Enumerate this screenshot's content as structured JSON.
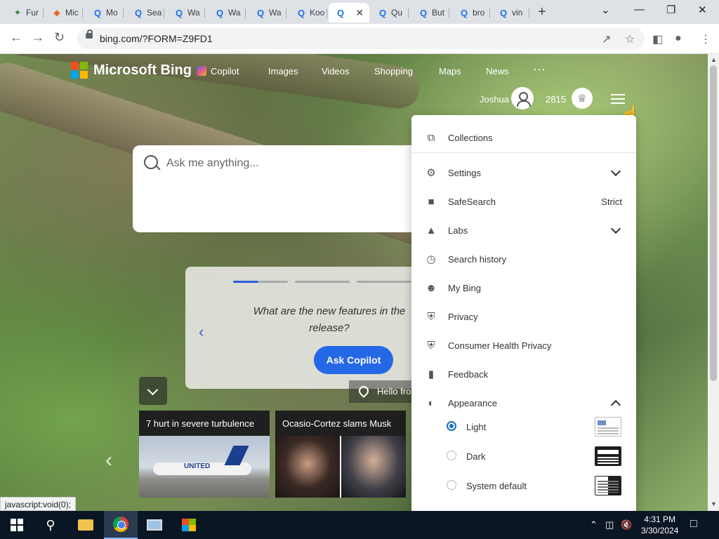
{
  "browser": {
    "tabs": [
      {
        "label": "Fur",
        "icon": "leaf"
      },
      {
        "label": "Mic",
        "icon": "shield"
      },
      {
        "label": "Mo",
        "icon": "search"
      },
      {
        "label": "Sea",
        "icon": "search"
      },
      {
        "label": "Wa",
        "icon": "search"
      },
      {
        "label": "Wa",
        "icon": "search"
      },
      {
        "label": "Wa",
        "icon": "search"
      },
      {
        "label": "Koo",
        "icon": "search"
      },
      {
        "label": "",
        "icon": "search",
        "active": true
      },
      {
        "label": "Qu",
        "icon": "search"
      },
      {
        "label": "But",
        "icon": "search"
      },
      {
        "label": "bro",
        "icon": "search"
      },
      {
        "label": "vin",
        "icon": "search"
      }
    ],
    "url": "bing.com/?FORM=Z9FD1",
    "status_text": "javascript:void(0);"
  },
  "bing": {
    "logo_text": "Microsoft Bing",
    "nav": [
      "Copilot",
      "Images",
      "Videos",
      "Shopping",
      "Maps",
      "News"
    ],
    "more": "···",
    "user_name": "Joshua",
    "points": "2815",
    "search_placeholder": "Ask me anything...",
    "prompt_question": "What are the new features in the release?",
    "ask_button": "Ask Copilot",
    "hello_text": "Hello fro",
    "carousel_active_index": 0,
    "news": [
      {
        "headline": "7 hurt in severe turbulence",
        "image": "airplane",
        "image_text": "UNITED"
      },
      {
        "headline": "Ocasio-Cortez slams Musk",
        "image": "people"
      }
    ]
  },
  "menu": {
    "items": [
      {
        "label": "Collections",
        "icon": "collections"
      },
      {
        "label": "Settings",
        "icon": "gear",
        "chevron": "down"
      },
      {
        "label": "SafeSearch",
        "icon": "lock",
        "value": "Strict"
      },
      {
        "label": "Labs",
        "icon": "flask",
        "chevron": "down"
      },
      {
        "label": "Search history",
        "icon": "clock"
      },
      {
        "label": "My Bing",
        "icon": "person-star"
      },
      {
        "label": "Privacy",
        "icon": "shield"
      },
      {
        "label": "Consumer Health Privacy",
        "icon": "shield"
      },
      {
        "label": "Feedback",
        "icon": "chat"
      },
      {
        "label": "Appearance",
        "icon": "contrast",
        "chevron": "up"
      }
    ],
    "appearance_options": [
      {
        "label": "Light",
        "selected": true
      },
      {
        "label": "Dark",
        "selected": false
      },
      {
        "label": "System default",
        "selected": false
      }
    ]
  },
  "taskbar": {
    "time": "4:31 PM",
    "date": "3/30/2024"
  },
  "colors": {
    "accent": "#2568e6",
    "ms_red": "#f25022",
    "ms_green": "#7fba00",
    "ms_blue": "#00a4ef",
    "ms_yellow": "#ffb900"
  }
}
